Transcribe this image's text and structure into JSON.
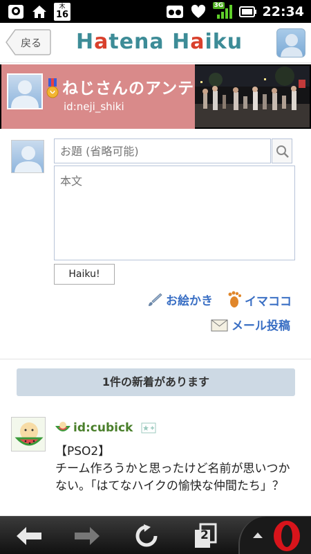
{
  "status_bar": {
    "time": "22:34",
    "calendar_day_label": "木",
    "calendar_day_number": "16",
    "network_label": "3G"
  },
  "header": {
    "back_label": "戻る",
    "logo_part1": "H",
    "logo_part2": "a",
    "logo_part3": "tena",
    "logo_part4": "H",
    "logo_part5": "a",
    "logo_part6": "iku"
  },
  "banner": {
    "title": "ねじさんのアンテナ",
    "user_id": "id:neji_shiki"
  },
  "compose": {
    "title_placeholder": "お題 (省略可能)",
    "body_placeholder": "本文",
    "submit_label": "Haiku!",
    "draw_label": "お絵かき",
    "imacoco_label": "イマココ",
    "mail_label": "メール投稿"
  },
  "feed": {
    "new_items_label": "1件の新着があります",
    "post": {
      "user_id": "id:cubick",
      "body_line1": "【PSO2】",
      "body_line2": "チーム作ろうかと思ったけど名前が思いつかない。「はてなハイクの愉快な仲間たち」？"
    }
  },
  "bottom_bar": {
    "tabs_count": "2"
  },
  "colors": {
    "accent_blue": "#3a6fc4",
    "logo_teal": "#3d8c97",
    "logo_red": "#d9402c",
    "banner_pink": "#d98a8a",
    "new_items_bg": "#cdd9e4",
    "user_green": "#4a7f2b"
  }
}
